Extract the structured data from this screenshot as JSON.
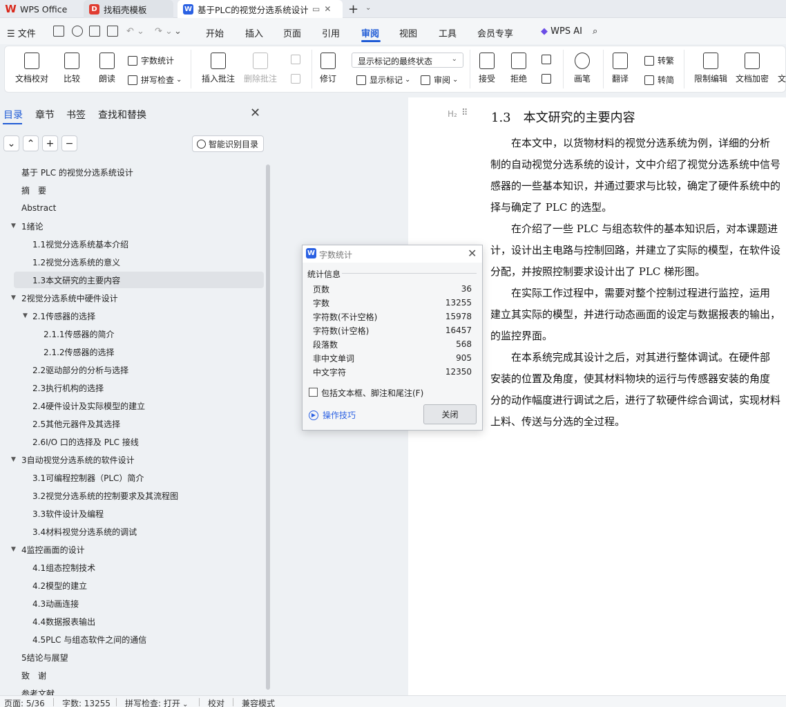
{
  "titlebar": {
    "tabs": [
      {
        "label": "WPS Office"
      },
      {
        "label": "找稻壳模板"
      },
      {
        "label": "基于PLC的视觉分选系统设计"
      }
    ],
    "new_tab": "+"
  },
  "menubar": {
    "file_label": "文件",
    "items": [
      "开始",
      "插入",
      "页面",
      "引用",
      "审阅",
      "视图",
      "工具",
      "会员专享"
    ],
    "active": "审阅",
    "ai_label": "WPS AI"
  },
  "ribbon": {
    "doc_check": "文档校对",
    "compare": "比较",
    "read_aloud": "朗读",
    "word_count": "字数统计",
    "spell_check": "拼写检查",
    "insert_comment": "插入批注",
    "delete_comment": "删除批注",
    "revise": "修订",
    "markup_select": "显示标记的最终状态",
    "show_markup": "显示标记",
    "review": "审阅",
    "accept": "接受",
    "reject": "拒绝",
    "pen": "画笔",
    "translate": "翻译",
    "to_traditional": "转繁",
    "to_simplified": "转简",
    "restrict_edit": "限制编辑",
    "doc_encrypt": "文档加密",
    "doc_more": "文"
  },
  "nav": {
    "tabs": [
      "目录",
      "章节",
      "书签",
      "查找和替换"
    ],
    "smart_toc": "智能识别目录",
    "toc": [
      {
        "label": "基于 PLC 的视觉分选系统设计",
        "level": 0
      },
      {
        "label": "摘　要",
        "level": 0
      },
      {
        "label": "Abstract",
        "level": 0
      },
      {
        "label": "1绪论",
        "level": 0,
        "expanded": true
      },
      {
        "label": "1.1视觉分选系统基本介绍",
        "level": 1
      },
      {
        "label": "1.2视觉分选系统的意义",
        "level": 1
      },
      {
        "label": "1.3本文研究的主要内容",
        "level": 1,
        "selected": true
      },
      {
        "label": "2视觉分选系统中硬件设计",
        "level": 0,
        "expanded": true
      },
      {
        "label": "2.1传感器的选择",
        "level": 1,
        "expanded": true
      },
      {
        "label": "2.1.1传感器的简介",
        "level": 2
      },
      {
        "label": "2.1.2传感器的选择",
        "level": 2
      },
      {
        "label": "2.2驱动部分的分析与选择",
        "level": 1
      },
      {
        "label": "2.3执行机构的选择",
        "level": 1
      },
      {
        "label": "2.4硬件设计及实际模型的建立",
        "level": 1
      },
      {
        "label": "2.5其他元器件及其选择",
        "level": 1
      },
      {
        "label": "2.6I/O 口的选择及 PLC 接线",
        "level": 1
      },
      {
        "label": "3自动视觉分选系统的软件设计",
        "level": 0,
        "expanded": true
      },
      {
        "label": "3.1可编程控制器（PLC）简介",
        "level": 1
      },
      {
        "label": "3.2视觉分选系统的控制要求及其流程图",
        "level": 1
      },
      {
        "label": "3.3软件设计及编程",
        "level": 1
      },
      {
        "label": "3.4材料视觉分选系统的调试",
        "level": 1
      },
      {
        "label": "4监控画面的设计",
        "level": 0,
        "expanded": true
      },
      {
        "label": "4.1组态控制技术",
        "level": 1
      },
      {
        "label": "4.2模型的建立",
        "level": 1
      },
      {
        "label": "4.3动画连接",
        "level": 1
      },
      {
        "label": "4.4数据报表输出",
        "level": 1
      },
      {
        "label": "4.5PLC 与组态软件之间的通信",
        "level": 1
      },
      {
        "label": "5结论与展望",
        "level": 0
      },
      {
        "label": "致　谢",
        "level": 0
      },
      {
        "label": "参考文献",
        "level": 0
      }
    ]
  },
  "document": {
    "heading_marker": "H₂",
    "heading": "1.3　本文研究的主要内容",
    "lines": [
      "　　在本文中，以货物材料的视觉分选系统为例，详细的分析",
      "制的自动视觉分选系统的设计，文中介绍了视觉分选系统中信号",
      "感器的一些基本知识，并通过要求与比较，确定了硬件系统中的",
      "择与确定了 PLC 的选型。",
      "　　在介绍了一些 PLC 与组态软件的基本知识后，对本课题进",
      "计，设计出主电路与控制回路，并建立了实际的模型，在软件设",
      "分配，并按照控制要求设计出了 PLC 梯形图。",
      "　　在实际工作过程中，需要对整个控制过程进行监控，运用",
      "建立其实际的模型，并进行动态画面的设定与数据报表的输出，",
      "的监控界面。",
      "　　在本系统完成其设计之后，对其进行整体调试。在硬件部",
      "安装的位置及角度，使其材料物块的运行与传感器安装的角度",
      "分的动作幅度进行调试之后，进行了软硬件综合调试，实现材料",
      "上料、传送与分选的全过程。"
    ]
  },
  "dialog": {
    "title": "字数统计",
    "section": "统计信息",
    "stats": [
      {
        "label": "页数",
        "value": "36"
      },
      {
        "label": "字数",
        "value": "13255"
      },
      {
        "label": "字符数(不计空格)",
        "value": "15978"
      },
      {
        "label": "字符数(计空格)",
        "value": "16457"
      },
      {
        "label": "段落数",
        "value": "568"
      },
      {
        "label": "非中文单词",
        "value": "905"
      },
      {
        "label": "中文字符",
        "value": "12350"
      }
    ],
    "checkbox_label": "包括文本框、脚注和尾注(F)",
    "checkbox_checked": false,
    "tips_label": "操作技巧",
    "close_button": "关闭"
  },
  "statusbar": {
    "page": "页面: 5/36",
    "word_count": "字数: 13255",
    "spell_check": "拼写检查: 打开",
    "proof": "校对",
    "compat": "兼容模式"
  },
  "colors": {
    "accent": "#1f5bd6",
    "wps_red": "#d9281b"
  }
}
